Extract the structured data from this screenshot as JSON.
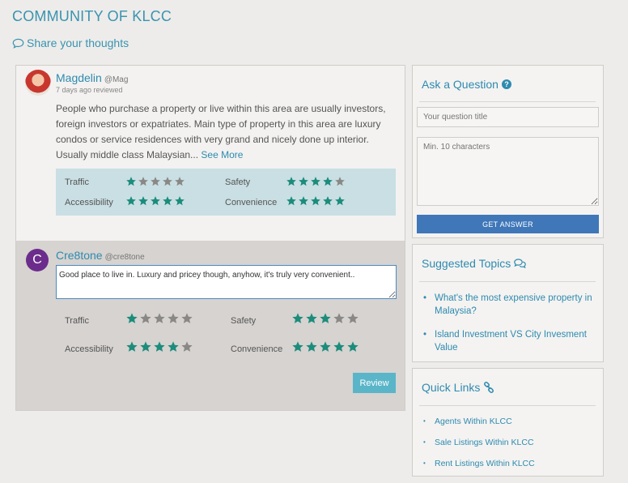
{
  "header": {
    "title": "COMMUNITY OF KLCC",
    "share_label": "Share your thoughts"
  },
  "review": {
    "user_name": "Magdelin",
    "user_handle": "@Mag",
    "time": "7 days ago reviewed",
    "text": "People who purchase a property or live within this area are usually investors, foreign investors or expatriates. Main type of property in this area are luxury condos or service residences with very grand and nicely done up interior. Usually middle class Malaysian...",
    "see_more": "See More",
    "ratings": [
      {
        "label": "Traffic",
        "stars": 1
      },
      {
        "label": "Safety",
        "stars": 4
      },
      {
        "label": "Accessibility",
        "stars": 5
      },
      {
        "label": "Convenience",
        "stars": 5
      }
    ]
  },
  "composer": {
    "avatar_letter": "C",
    "user_name": "Cre8tone",
    "user_handle": "@cre8tone",
    "input_value": "Good place to live in. Luxury and pricey though, anyhow, it's truly very convenient..",
    "ratings": [
      {
        "label": "Traffic",
        "stars": 1
      },
      {
        "label": "Safety",
        "stars": 3
      },
      {
        "label": "Accessibility",
        "stars": 4
      },
      {
        "label": "Convenience",
        "stars": 5
      }
    ],
    "review_button": "Review"
  },
  "ask": {
    "title": "Ask a Question",
    "title_placeholder": "Your question title",
    "body_placeholder": "Min. 10 characters",
    "button": "GET ANSWER"
  },
  "suggested": {
    "title": "Suggested Topics",
    "items": [
      "What's the most expensive property in Malaysia?",
      "Island Investment VS City Invesment Value"
    ]
  },
  "quick_links": {
    "title": "Quick Links",
    "items": [
      "Agents Within KLCC",
      "Sale Listings Within KLCC",
      "Rent Listings Within KLCC"
    ]
  },
  "colors": {
    "accent": "#3a93b0",
    "star_on": "#1c8c7c",
    "star_off": "#8a8886",
    "button_blue": "#3f77b9",
    "button_teal": "#5ab5c9"
  }
}
